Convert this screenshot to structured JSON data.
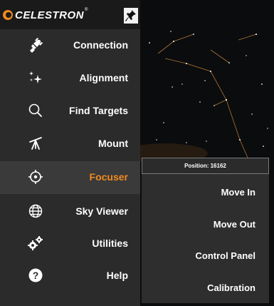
{
  "brand": {
    "name": "CELESTRON",
    "trademark": "®"
  },
  "menu": [
    {
      "label": "Connection",
      "icon": "plug-icon"
    },
    {
      "label": "Alignment",
      "icon": "sparkle-stars-icon"
    },
    {
      "label": "Find Targets",
      "icon": "search-icon"
    },
    {
      "label": "Mount",
      "icon": "telescope-icon"
    },
    {
      "label": "Focuser",
      "icon": "focus-target-icon",
      "active": true
    },
    {
      "label": "Sky Viewer",
      "icon": "globe-icon"
    },
    {
      "label": "Utilities",
      "icon": "gears-icon"
    },
    {
      "label": "Help",
      "icon": "question-icon"
    }
  ],
  "focuser_panel": {
    "position": "Position: 16162",
    "actions": [
      {
        "label": "Move In"
      },
      {
        "label": "Move Out"
      },
      {
        "label": "Control Panel"
      },
      {
        "label": "Calibration"
      }
    ]
  },
  "colors": {
    "accent": "#f08a1f",
    "sidebar": "#2b2b2b",
    "active_row": "#3a3a3a",
    "panel": "#2e2e2e"
  }
}
